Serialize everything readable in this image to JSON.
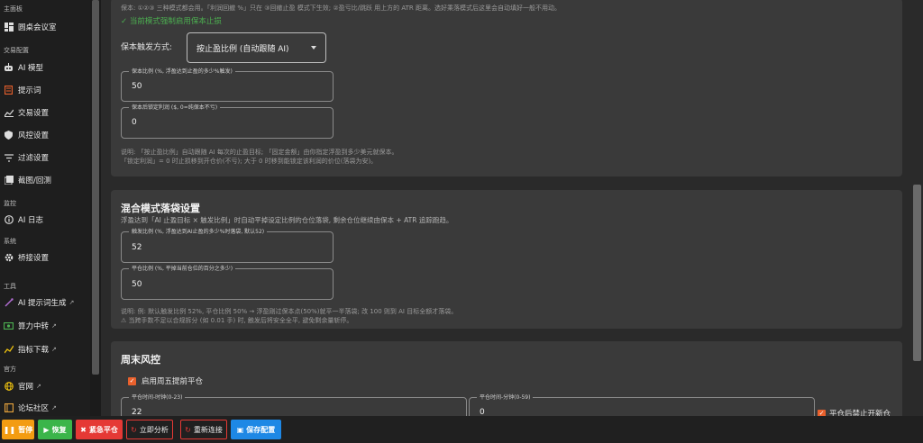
{
  "sidebar": {
    "sections": {
      "main": "主面板",
      "trade": "交易配置",
      "monitor": "监控",
      "system": "系统",
      "tools": "工具",
      "official": "官方"
    },
    "items": {
      "roundtable": "圆桌会议室",
      "ai_model": "AI 模型",
      "prompt": "提示词",
      "trade_settings": "交易设置",
      "risk_settings": "风控设置",
      "filter_settings": "过滤设置",
      "screenshot_backtest": "截图/回测",
      "ai_log": "AI 日志",
      "bridge_settings": "桥接设置",
      "prompt_gen": "AI 提示词生成",
      "compute_relay": "算力中转",
      "indicator_download": "指标下载",
      "website": "官网",
      "forum": "论坛社区"
    }
  },
  "protect": {
    "note_top": "保本: ①②③ 三种模式都会用。「利润回撤 %」只在 ③回撤止盈 模式下生效; ②盈亏比/跳跃 用上方的 ATR 距离。选好乘落模式后这里会自动填好一般不用动。",
    "forced_text": "✓ 当前模式强制启用保本止损",
    "trigger_label": "保本触发方式:",
    "trigger_value": "按止盈比例 (自动跟随 AI)",
    "ratio_label": "保本比例 (%, 浮盈达到止盈的多少%触发)",
    "ratio_value": "50",
    "lock_label": "保本后锁定利润 ($, 0=纯保本不亏)",
    "lock_value": "0",
    "note1": "说明: 「按止盈比例」自动跟随 AI 每次的止盈目标; 「固定金额」由你指定浮盈到多少美元就保本。",
    "note2": "「锁定利润」= 0 时止损移到开仓价(不亏); 大于 0 时移到能锁定该利润的价位(落袋为安)。"
  },
  "hybrid": {
    "title": "混合模式落袋设置",
    "desc": "浮盈达到「AI 止盈目标 × 触发比例」时自动平掉设定比例的仓位落袋, 剩余仓位继续由保本 + ATR 追踪跑趋。",
    "trigger_label": "触发比例 (%, 浮盈达到AI止盈的多少%时落袋, 默认52)",
    "trigger_value": "52",
    "close_label": "平仓比例 (%, 平掉当前仓位的百分之多少)",
    "close_value": "50",
    "note1": "说明: 例: 默认触发比例 52%, 平仓比例 50% → 浮盈刚过保本点(50%)就平一半落袋; 改 100 则到 AI 目标全额才落袋。",
    "note2": "⚠ 当跨手数不足以合规拆分 (如 0.01 手) 时, 触发后将安全全平, 避免剩余量斩停。"
  },
  "weekend": {
    "title": "周末风控",
    "close_label": "启用周五提前平仓",
    "hour_label": "平仓时间-时钟(0-23)",
    "hour_value": "22",
    "minute_label": "平仓时间-分钟(0-59)",
    "minute_value": "0",
    "no_open_label": "平仓后禁止开新仓"
  },
  "toolbar": {
    "pause": "暂停",
    "resume": "恢复",
    "emergency": "紧急平仓",
    "analyze": "立即分析",
    "reconnect": "重新连接",
    "save": "保存配置"
  },
  "colors": {
    "accent": "#e8602c",
    "green": "#4caf50",
    "orange": "#f39c12",
    "red": "#e53935",
    "blue": "#1e88e5"
  }
}
